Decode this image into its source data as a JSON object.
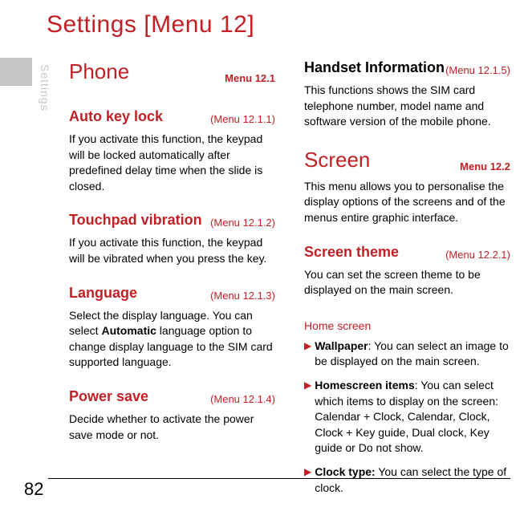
{
  "page_title": "Settings [Menu 12]",
  "side_tab": "Settings",
  "page_number": "82",
  "left": {
    "phone": {
      "title": "Phone",
      "ref": "Menu 12.1"
    },
    "auto_key_lock": {
      "title": "Auto key lock",
      "ref": "(Menu 12.1.1)",
      "body": "If you activate this function, the keypad will be locked automatically after predefined delay time when the slide is closed."
    },
    "touchpad": {
      "title": "Touchpad vibration",
      "ref": "(Menu 12.1.2)",
      "body": "If you activate this function, the keypad will be vibrated when you press the key."
    },
    "language": {
      "title": "Language",
      "ref": "(Menu 12.1.3)",
      "body_pre": "Select the display language. You can select ",
      "body_bold": "Automatic",
      "body_post": " language option to change display language to the SIM card supported language."
    },
    "power_save": {
      "title": "Power save",
      "ref": "(Menu 12.1.4)",
      "body": "Decide whether to activate the power save mode or not."
    }
  },
  "right": {
    "handset": {
      "title": "Handset Information",
      "ref": "(Menu 12.1.5)",
      "body": "This functions shows the SIM card telephone number, model name and software version of the mobile phone."
    },
    "screen": {
      "title": "Screen",
      "ref": "Menu 12.2",
      "body": "This menu allows you to personalise the display options of the screens and of the menus entire graphic interface."
    },
    "screen_theme": {
      "title": "Screen theme",
      "ref": "(Menu 12.2.1)",
      "body": "You can set the screen theme to be displayed on the main screen."
    },
    "home_screen": {
      "title": "Home screen",
      "items": [
        {
          "bold": "Wallpaper",
          "sep": ": ",
          "text": "You can select an image to be displayed on the main screen."
        },
        {
          "bold": "Homescreen items",
          "sep": ": ",
          "text": "You can select which items to display on the screen: Calendar + Clock, Calendar, Clock, Clock + Key guide, Dual clock, Key guide or Do not show."
        },
        {
          "bold": "Clock type:",
          "sep": " ",
          "text": "You can select the type of clock."
        }
      ]
    }
  }
}
